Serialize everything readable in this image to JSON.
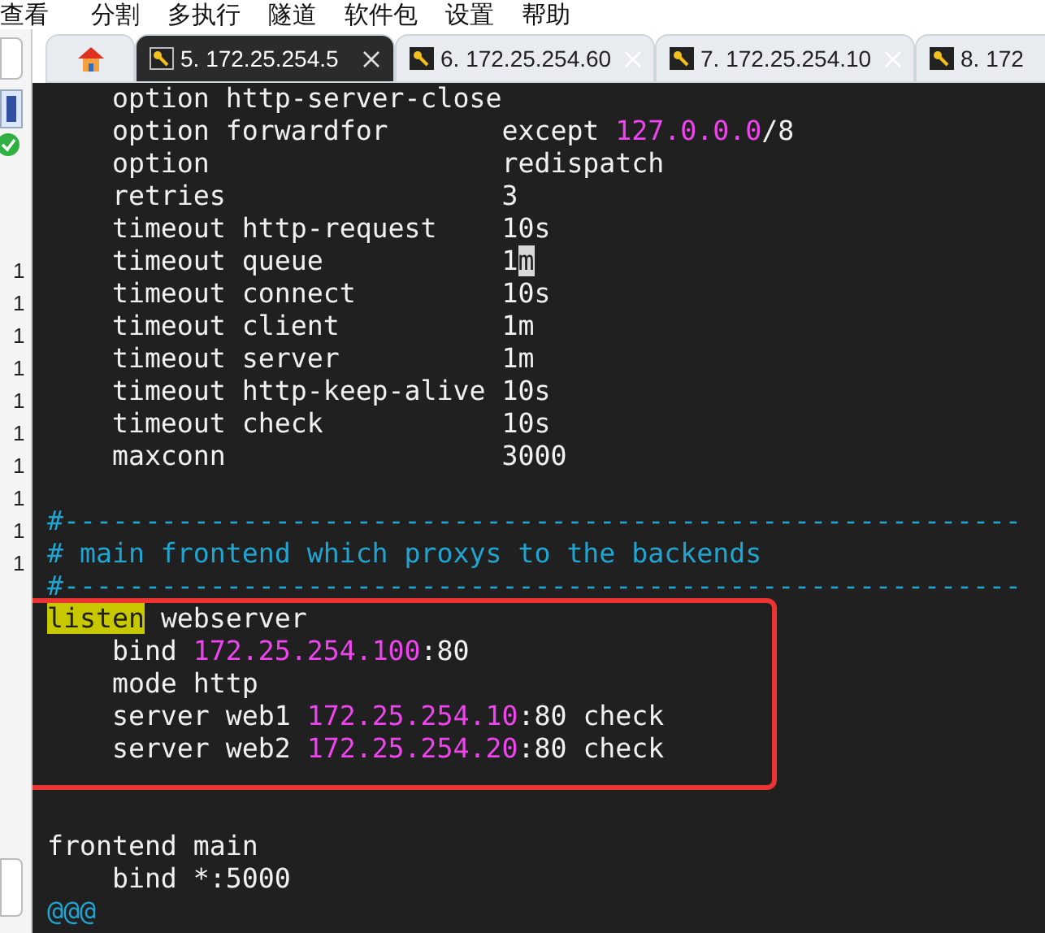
{
  "menu": [
    "查看",
    "分割",
    "多执行",
    "隧道",
    "软件包",
    "设置",
    "帮助"
  ],
  "tabs": [
    {
      "kind": "home",
      "selected": false
    },
    {
      "kind": "session",
      "label": "5. 172.25.254.5",
      "selected": true
    },
    {
      "kind": "session",
      "label": "6. 172.25.254.60",
      "selected": false
    },
    {
      "kind": "session",
      "label": "7. 172.25.254.10",
      "selected": false
    },
    {
      "kind": "session",
      "label": "8. 172",
      "selected": false
    }
  ],
  "sidebar": {
    "line_numbers": [
      "1",
      "1",
      "1",
      "1",
      "1",
      "1",
      "1",
      "1",
      "1",
      "1"
    ]
  },
  "terminal": {
    "lines": [
      {
        "kind": "code",
        "segments": [
          {
            "kind": "text",
            "text": "    option http-server-close"
          }
        ]
      },
      {
        "kind": "code",
        "segments": [
          {
            "kind": "text",
            "text": "    option forwardfor       except "
          },
          {
            "kind": "ip",
            "text": "127.0.0.0"
          },
          {
            "kind": "text",
            "text": "/8"
          }
        ]
      },
      {
        "kind": "code",
        "segments": [
          {
            "kind": "text",
            "text": "    option                  redispatch"
          }
        ]
      },
      {
        "kind": "code",
        "segments": [
          {
            "kind": "text",
            "text": "    retries                 3"
          }
        ]
      },
      {
        "kind": "code",
        "segments": [
          {
            "kind": "text",
            "text": "    timeout http-request    10s"
          }
        ]
      },
      {
        "kind": "code",
        "segments": [
          {
            "kind": "text",
            "text": "    timeout queue           1"
          },
          {
            "kind": "cursor",
            "text": "m"
          }
        ]
      },
      {
        "kind": "code",
        "segments": [
          {
            "kind": "text",
            "text": "    timeout connect         10s"
          }
        ]
      },
      {
        "kind": "code",
        "segments": [
          {
            "kind": "text",
            "text": "    timeout client          1m"
          }
        ]
      },
      {
        "kind": "code",
        "segments": [
          {
            "kind": "text",
            "text": "    timeout server          1m"
          }
        ]
      },
      {
        "kind": "code",
        "segments": [
          {
            "kind": "text",
            "text": "    timeout http-keep-alive 10s"
          }
        ]
      },
      {
        "kind": "code",
        "segments": [
          {
            "kind": "text",
            "text": "    timeout check           10s"
          }
        ]
      },
      {
        "kind": "code",
        "segments": [
          {
            "kind": "text",
            "text": "    maxconn                 3000"
          }
        ]
      },
      {
        "kind": "blank"
      },
      {
        "kind": "code",
        "segments": [
          {
            "kind": "comment",
            "text": "#-----------------------------------------------------------"
          }
        ]
      },
      {
        "kind": "code",
        "segments": [
          {
            "kind": "comment",
            "text": "# main frontend which proxys to the backends"
          }
        ]
      },
      {
        "kind": "code",
        "segments": [
          {
            "kind": "comment",
            "text": "#-----------------------------------------------------------"
          }
        ]
      },
      {
        "kind": "code",
        "segments": [
          {
            "kind": "highlight",
            "text": "listen"
          },
          {
            "kind": "text",
            "text": " webserver"
          }
        ]
      },
      {
        "kind": "code",
        "segments": [
          {
            "kind": "text",
            "text": "    bind "
          },
          {
            "kind": "ip",
            "text": "172.25.254.100"
          },
          {
            "kind": "text",
            "text": ":80"
          }
        ]
      },
      {
        "kind": "code",
        "segments": [
          {
            "kind": "text",
            "text": "    mode http"
          }
        ]
      },
      {
        "kind": "code",
        "segments": [
          {
            "kind": "text",
            "text": "    server web1 "
          },
          {
            "kind": "ip",
            "text": "172.25.254.10"
          },
          {
            "kind": "text",
            "text": ":80 check"
          }
        ]
      },
      {
        "kind": "code",
        "segments": [
          {
            "kind": "text",
            "text": "    server web2 "
          },
          {
            "kind": "ip",
            "text": "172.25.254.20"
          },
          {
            "kind": "text",
            "text": ":80 check"
          }
        ]
      },
      {
        "kind": "blank"
      },
      {
        "kind": "blank"
      },
      {
        "kind": "code",
        "segments": [
          {
            "kind": "text",
            "text": "frontend main"
          }
        ]
      },
      {
        "kind": "code",
        "segments": [
          {
            "kind": "text",
            "text": "    bind *:5000"
          }
        ]
      },
      {
        "kind": "code",
        "segments": [
          {
            "kind": "comment",
            "text": "@@@"
          }
        ]
      }
    ]
  }
}
